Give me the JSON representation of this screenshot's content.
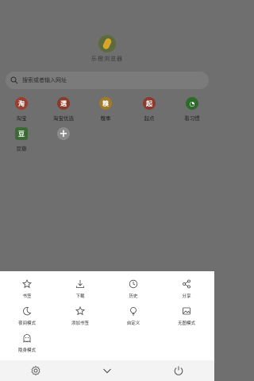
{
  "brand": {
    "name": "乐橙浏览器"
  },
  "search": {
    "placeholder": "搜索或者输入网址"
  },
  "shortcuts": [
    {
      "label": "淘宝",
      "icon": "taobao-icon",
      "color": "#9a3f30",
      "glyph": "淘"
    },
    {
      "label": "淘宝优选",
      "icon": "taobao-youxuan-icon",
      "color": "#8a3a2a",
      "glyph": "選"
    },
    {
      "label": "糗事",
      "icon": "qiushi-icon",
      "color": "#a07a26",
      "glyph": "糗"
    },
    {
      "label": "起点",
      "icon": "qidian-icon",
      "color": "#8c3a2d",
      "glyph": "起"
    },
    {
      "label": "看习惯",
      "icon": "kanxiguan-icon",
      "color": "#2c6b2a",
      "glyph": "◔"
    },
    {
      "label": "豆瓣",
      "icon": "douban-icon",
      "color": "#3b6a34",
      "glyph": "豆"
    },
    {
      "label": "",
      "icon": "add-shortcut-icon",
      "color": "#8a8a8a",
      "glyph": "+"
    }
  ],
  "menu": {
    "items": [
      {
        "label": "书签",
        "icon": "star-icon"
      },
      {
        "label": "下载",
        "icon": "download-icon"
      },
      {
        "label": "历史",
        "icon": "clock-icon"
      },
      {
        "label": "分享",
        "icon": "share-icon"
      },
      {
        "label": "夜间模式",
        "icon": "moon-icon"
      },
      {
        "label": "添加书签",
        "icon": "star-plus-icon"
      },
      {
        "label": "自定义",
        "icon": "lightbulb-icon"
      },
      {
        "label": "无图模式",
        "icon": "image-icon"
      },
      {
        "label": "隐身模式",
        "icon": "ghost-icon"
      }
    ]
  },
  "bottom_bar": {
    "settings": "gear-icon",
    "collapse": "chevron-down-icon",
    "exit": "power-icon"
  }
}
